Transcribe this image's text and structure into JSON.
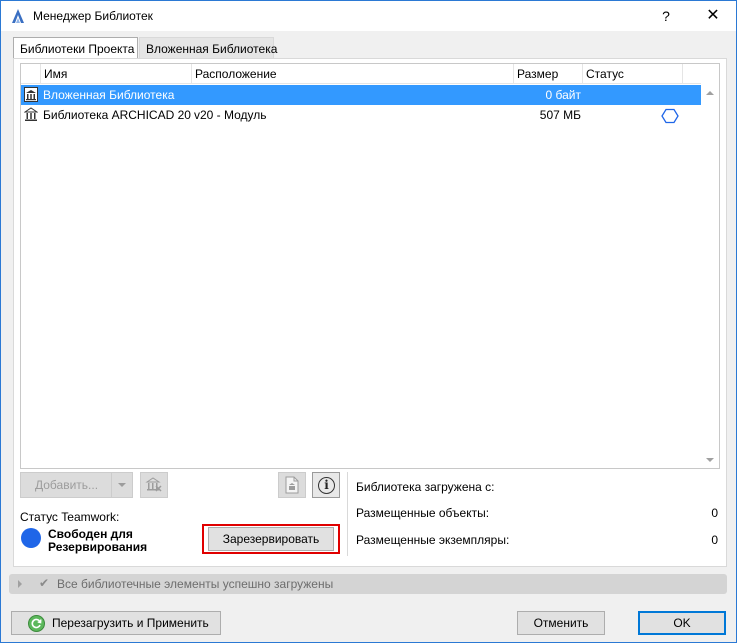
{
  "window": {
    "title": "Менеджер Библиотек",
    "help_label": "?",
    "close_label": "✕"
  },
  "tabs": [
    {
      "label": "Библиотеки Проекта",
      "active": true
    },
    {
      "label": "Вложенная Библиотека",
      "active": false
    }
  ],
  "library_table": {
    "columns": [
      "Имя",
      "Расположение",
      "Размер",
      "Статус"
    ],
    "rows": [
      {
        "name": "Вложенная Библиотека",
        "location": "",
        "size": "0 байт",
        "status_icon": "",
        "selected": true
      },
      {
        "name": "Библиотека ARCHICAD 20",
        "location": "v20 - Модуль",
        "size": "507 МБ",
        "status_icon": "hexagon-status-icon",
        "selected": false
      }
    ]
  },
  "toolbar": {
    "add_label": "Добавить...",
    "remove_icon": "remove-library-icon",
    "doc_icon": "library-report-icon",
    "info_icon": "info-icon",
    "info_glyph": "i"
  },
  "teamwork": {
    "label": "Статус Teamwork:",
    "status": "Свободен для Резервирования",
    "status_color": "#1f66e8",
    "reserve_label": "Зарезервировать"
  },
  "library_info": {
    "loaded_from_label": "Библиотека загружена с:",
    "placed_objects_label": "Размещенные объекты:",
    "placed_objects_value": "0",
    "placed_instances_label": "Размещенные экземпляры:",
    "placed_instances_value": "0"
  },
  "status_bar": {
    "check_glyph": "✔",
    "text": "Все библиотечные элементы успешно загружены"
  },
  "footer": {
    "reload_label": "Перезагрузить и Применить",
    "cancel_label": "Отменить",
    "ok_label": "OK"
  },
  "colors": {
    "selection": "#3399ff",
    "accent": "#0078d7",
    "highlight_frame": "#e00000"
  }
}
